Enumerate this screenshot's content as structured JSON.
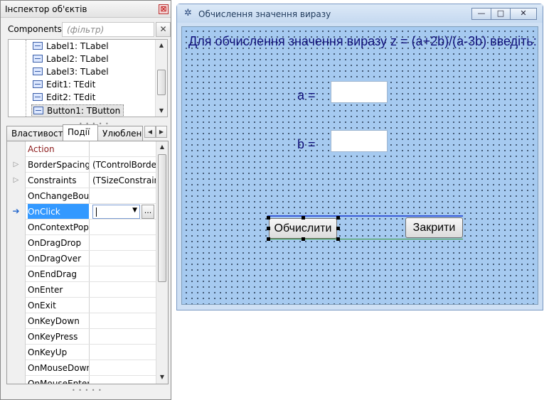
{
  "inspector": {
    "title": "Інспектор об'єктів",
    "components_label": "Components",
    "filter_placeholder": "(фільтр)",
    "tree_items": [
      {
        "label": "Label1: TLabel"
      },
      {
        "label": "Label2: TLabel"
      },
      {
        "label": "Label3: TLabel"
      },
      {
        "label": "Edit1: TEdit"
      },
      {
        "label": "Edit2: TEdit"
      },
      {
        "label": "Button1: TButton",
        "selected": true
      }
    ],
    "tabs": [
      "Властивості",
      "Події",
      "Улюблені"
    ],
    "active_tab": "Події",
    "rows": [
      {
        "name": "Action",
        "value": "",
        "type": "section"
      },
      {
        "name": "BorderSpacing",
        "value": "(TControlBorderSpacing)",
        "expandable": true
      },
      {
        "name": "Constraints",
        "value": "(TSizeConstraints)",
        "expandable": true
      },
      {
        "name": "OnChangeBounds",
        "value": ""
      },
      {
        "name": "OnClick",
        "value": "",
        "selected": true
      },
      {
        "name": "OnContextPopup",
        "value": ""
      },
      {
        "name": "OnDragDrop",
        "value": ""
      },
      {
        "name": "OnDragOver",
        "value": ""
      },
      {
        "name": "OnEndDrag",
        "value": ""
      },
      {
        "name": "OnEnter",
        "value": ""
      },
      {
        "name": "OnExit",
        "value": ""
      },
      {
        "name": "OnKeyDown",
        "value": ""
      },
      {
        "name": "OnKeyPress",
        "value": ""
      },
      {
        "name": "OnKeyUp",
        "value": ""
      },
      {
        "name": "OnMouseDown",
        "value": ""
      },
      {
        "name": "OnMouseEnter",
        "value": ""
      }
    ],
    "ellipsis_label": "...",
    "close_glyph": "⊠",
    "filter_clear_glyph": "✕"
  },
  "form": {
    "title": "Обчислення значення виразу",
    "heading": "Для обчислення значення виразу z = (a+2b)/(a-3b) введіть:",
    "label_a": "a =",
    "label_b": "b =",
    "edit_a_value": "",
    "edit_b_value": "",
    "btn_compute": "Обчислити",
    "btn_close": "Закрити",
    "win_buttons": {
      "minimize": "—",
      "maximize": "□",
      "close": "✕"
    },
    "icon_glyph": "✲"
  },
  "colors": {
    "client_bg": "#a6caf0",
    "label_text": "#10107a",
    "selection": "#3399ff"
  }
}
